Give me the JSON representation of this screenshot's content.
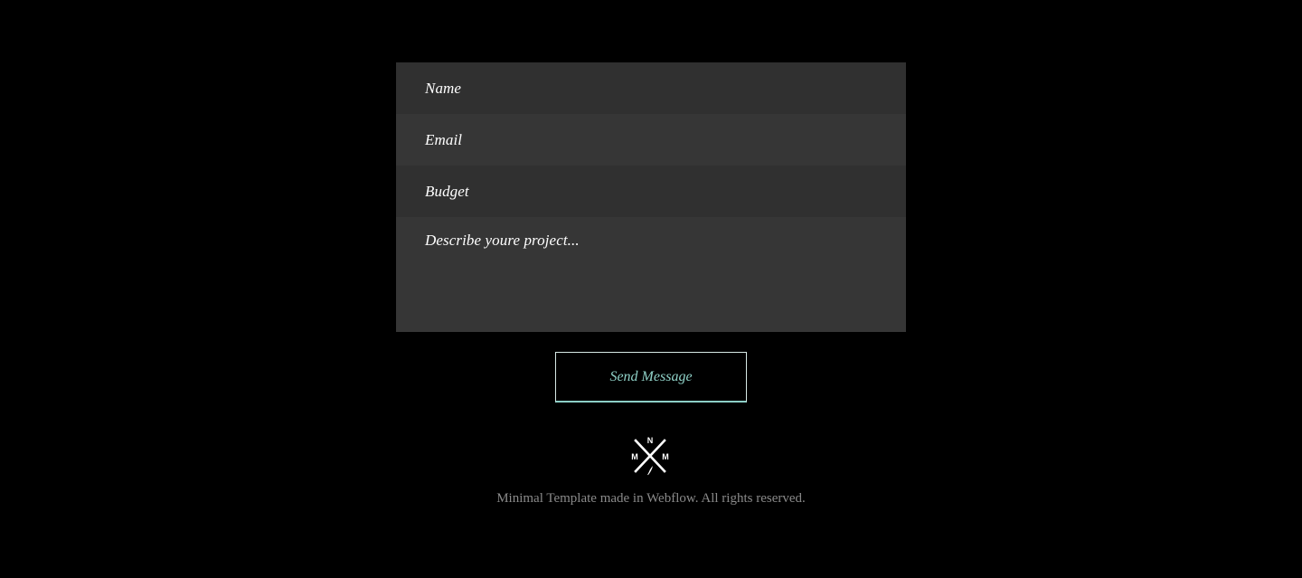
{
  "form": {
    "name_placeholder": "Name",
    "email_placeholder": "Email",
    "budget_placeholder": "Budget",
    "message_placeholder": "Describe youre project..."
  },
  "send_button_label": "Send Message",
  "logo": {
    "icon": "crossed-arrows-monogram-icon",
    "letter_top": "N",
    "letter_left": "M",
    "letter_right": "M"
  },
  "footer": {
    "text": "Minimal Template made in Webflow. All rights reserved."
  },
  "colors": {
    "background": "#000000",
    "field_dark": "#303030",
    "field_light": "#363636",
    "accent": "#8fd1c7",
    "footer_text": "#8a8a8a"
  }
}
